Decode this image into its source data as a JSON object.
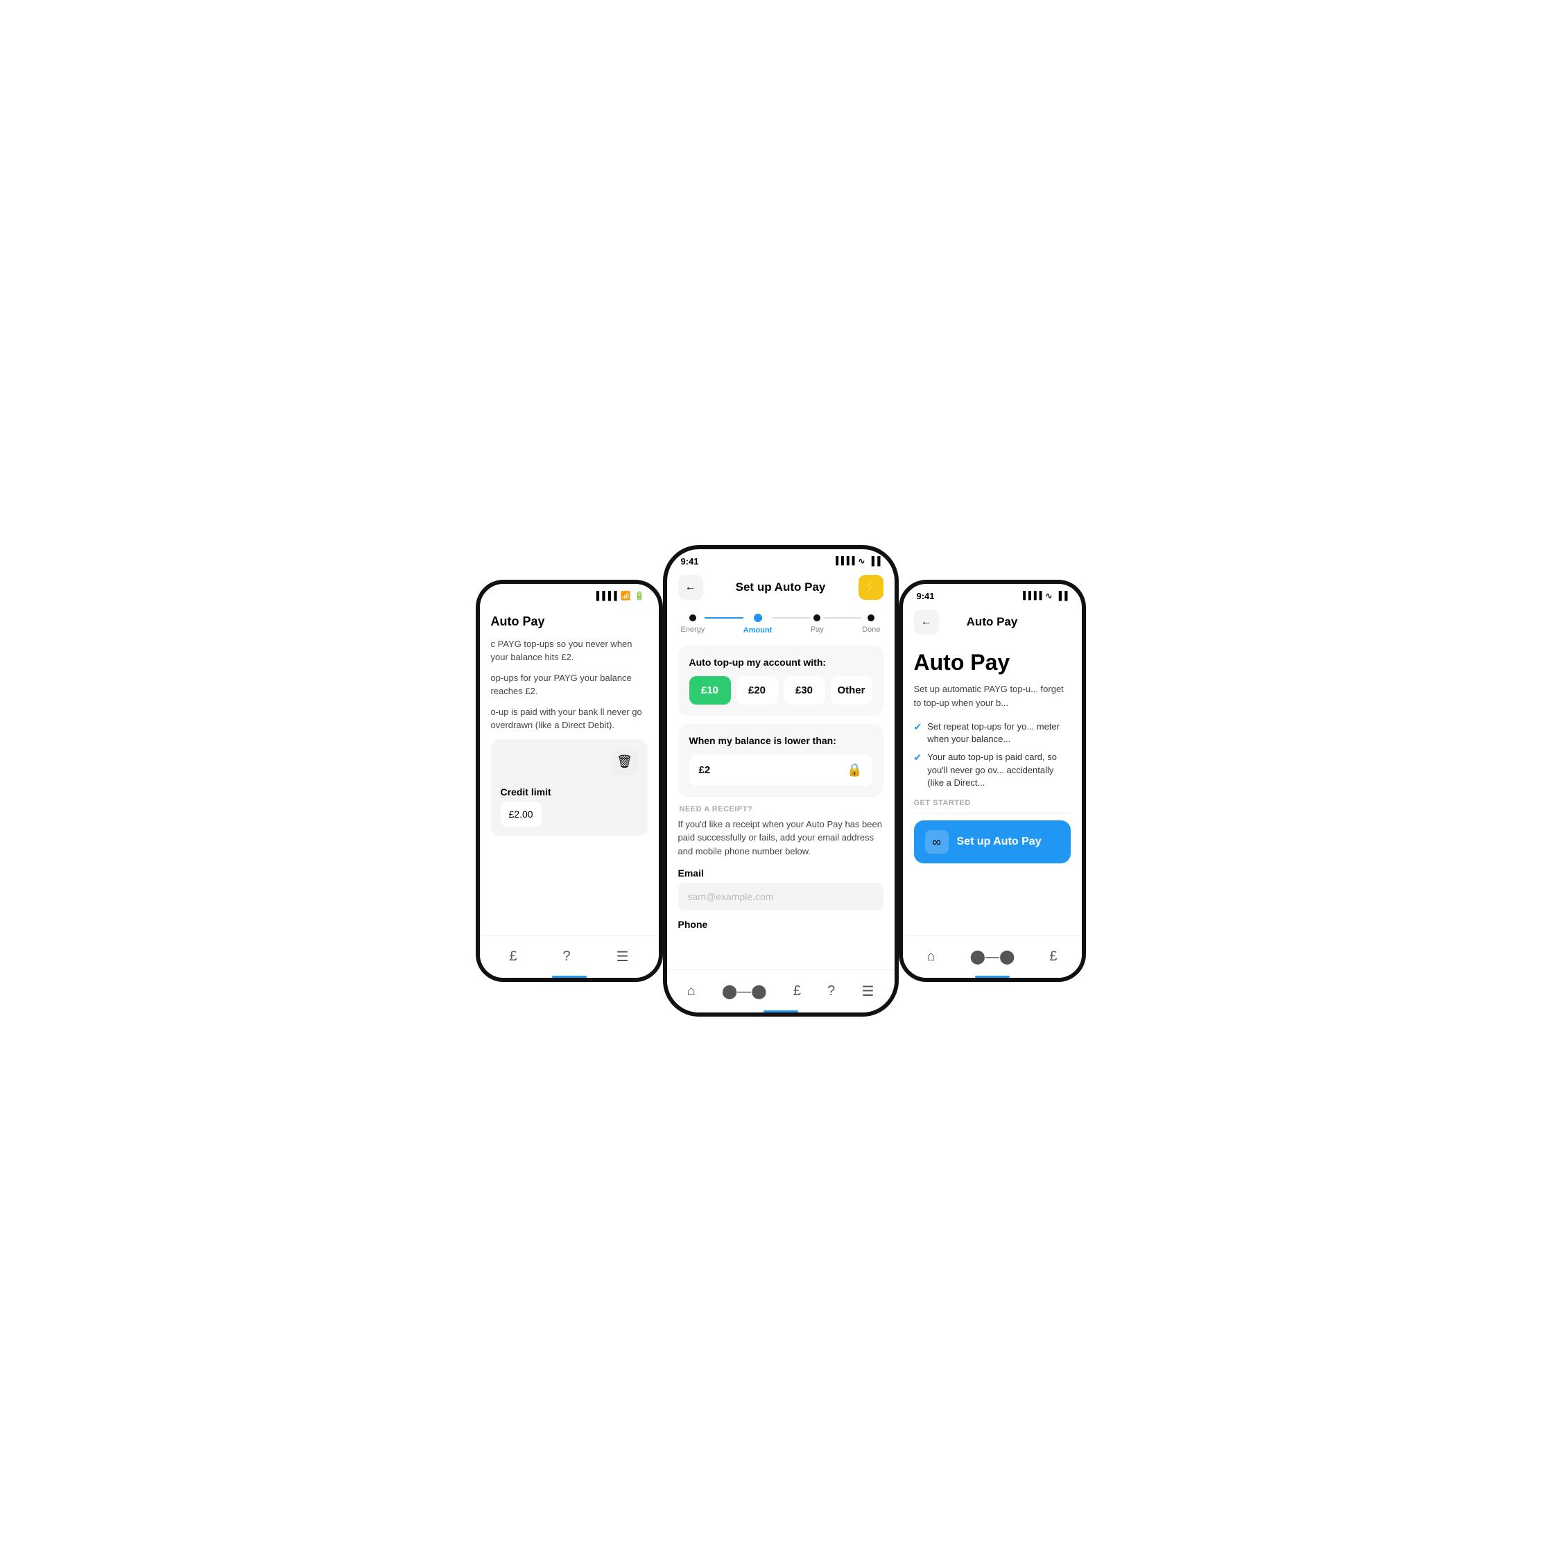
{
  "left_phone": {
    "page_title": "Auto Pay",
    "body_text_1": "c PAYG top-ups so you never when your balance hits £2.",
    "body_text_2": "op-ups for your PAYG your balance reaches £2.",
    "body_text_3": "o-up is paid with your bank ll never go overdrawn (like a Direct Debit).",
    "credit_label": "Credit limit",
    "credit_value": "£2.00"
  },
  "center_phone": {
    "status_time": "9:41",
    "header_title": "Set up Auto Pay",
    "steps": [
      {
        "label": "Energy",
        "state": "filled"
      },
      {
        "label": "Amount",
        "state": "active"
      },
      {
        "label": "Pay",
        "state": "default"
      },
      {
        "label": "Done",
        "state": "default"
      }
    ],
    "card_auto_topup": {
      "title": "Auto top-up my account with:",
      "options": [
        {
          "label": "£10",
          "selected": true
        },
        {
          "label": "£20",
          "selected": false
        },
        {
          "label": "£30",
          "selected": false
        },
        {
          "label": "Other",
          "selected": false
        }
      ]
    },
    "card_balance": {
      "title": "When my balance is lower than:",
      "value": "£2"
    },
    "receipt_section": {
      "label": "NEED A RECEIPT?",
      "desc": "If you'd like a receipt when your Auto Pay has been paid successfully or fails, add your email address and mobile phone number below.",
      "email_label": "Email",
      "email_placeholder": "sam@example.com",
      "phone_label": "Phone"
    },
    "nav_items": [
      "home",
      "route",
      "payment",
      "help",
      "menu"
    ]
  },
  "right_phone": {
    "status_time": "9:41",
    "header_title": "Auto Pay",
    "big_title": "Auto Pay",
    "desc": "Set up automatic PAYG top-u... forget to top-up when your b...",
    "checklist": [
      "Set repeat top-ups for yo... meter when your balance...",
      "Your auto top-up is paid card, so you'll never go ov... accidentally (like a Direct..."
    ],
    "get_started_label": "GET STARTED",
    "setup_btn_label": "Set up Auto Pay",
    "nav_items": [
      "home",
      "route",
      "payment"
    ]
  }
}
